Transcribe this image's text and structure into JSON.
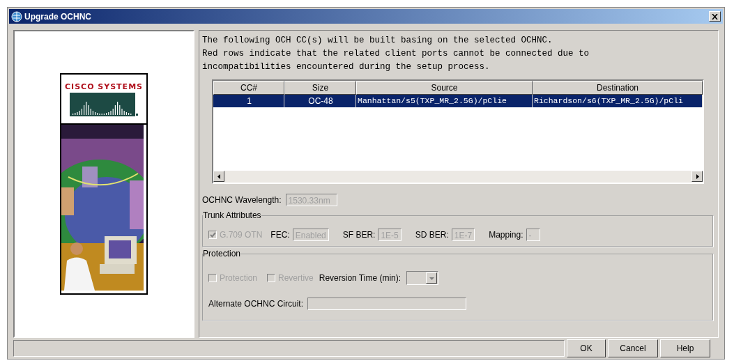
{
  "window": {
    "title": "Upgrade OCHNC"
  },
  "logo": {
    "text": "CISCO SYSTEMS"
  },
  "message": [
    "The following OCH CC(s) will be built basing on the selected OCHNC.",
    "Red rows indicate that the related client ports cannot be connected due to",
    "incompatibilities encountered during the setup process."
  ],
  "table": {
    "columns": [
      "CC#",
      "Size",
      "Source",
      "Destination"
    ],
    "rows": [
      {
        "cells": [
          "1",
          "OC-48",
          "Manhattan/s5(TXP_MR_2.5G)/pClie",
          "Richardson/s6(TXP_MR_2.5G)/pCli"
        ],
        "selected": true
      }
    ]
  },
  "wavelength": {
    "label": "OCHNC Wavelength:",
    "value": "1530.33nm"
  },
  "trunk": {
    "title": "Trunk Attributes",
    "otn": {
      "label": "G.709 OTN",
      "checked": true,
      "disabled": true
    },
    "fields": [
      {
        "label": "FEC:",
        "value": "Enabled"
      },
      {
        "label": "SF BER:",
        "value": "1E-5"
      },
      {
        "label": "SD BER:",
        "value": "1E-7"
      },
      {
        "label": "Mapping:",
        "value": "-"
      }
    ]
  },
  "protection": {
    "title": "Protection",
    "checkboxes": [
      {
        "label": "Protection",
        "checked": false,
        "disabled": true
      },
      {
        "label": "Revertive",
        "checked": false,
        "disabled": true
      }
    ],
    "reversion": {
      "label": "Reversion Time (min):"
    },
    "alternate": {
      "label": "Alternate OCHNC Circuit:"
    }
  },
  "buttons": [
    "OK",
    "Cancel",
    "Help"
  ]
}
